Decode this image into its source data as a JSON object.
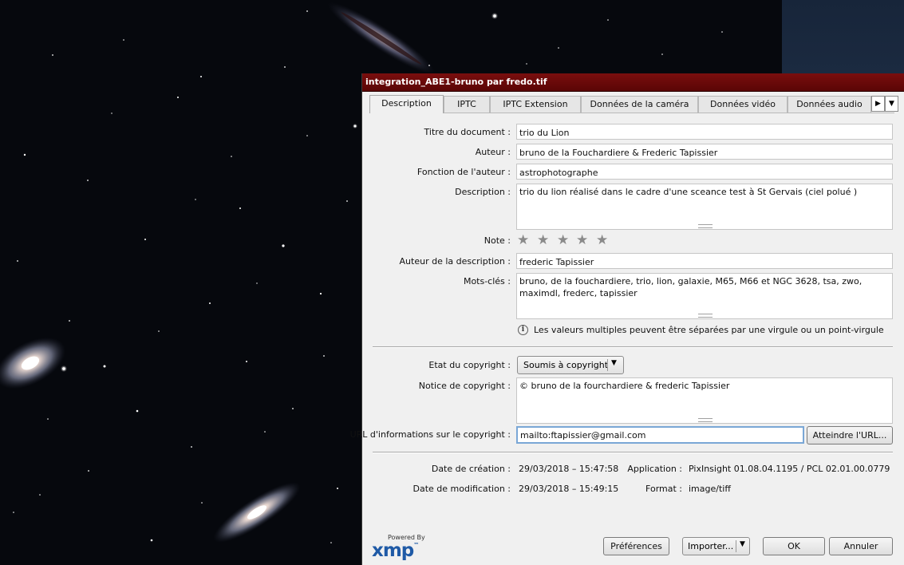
{
  "window": {
    "title": "integration_ABE1-bruno par fredo.tif"
  },
  "tabs": [
    {
      "label": "Description",
      "active": true
    },
    {
      "label": "IPTC"
    },
    {
      "label": "IPTC Extension"
    },
    {
      "label": "Données de la caméra"
    },
    {
      "label": "Données vidéo"
    },
    {
      "label": "Données audio"
    }
  ],
  "tab_scroll": {
    "right_icon": "triangle-right-icon",
    "menu_icon": "triangle-down-icon"
  },
  "form": {
    "document_title": {
      "label": "Titre du document :",
      "value": "trio du Lion"
    },
    "author": {
      "label": "Auteur :",
      "value": "bruno de la Fouchardiere & Frederic Tapissier"
    },
    "author_title": {
      "label": "Fonction de l'auteur :",
      "value": "astrophotographe"
    },
    "description": {
      "label": "Description :",
      "value": "trio du lion réalisé dans le cadre d'une sceance test à St Gervais (ciel polué )"
    },
    "rating": {
      "label": "Note :",
      "stars_total": 5,
      "stars_filled": 0
    },
    "description_writer": {
      "label": "Auteur de la description :",
      "value": "frederic Tapissier"
    },
    "keywords": {
      "label": "Mots-clés :",
      "value": "bruno, de la fouchardiere, trio, lion, galaxie, M65, M66 et NGC 3628, tsa, zwo, maximdl, frederc, tapissier"
    },
    "keywords_hint": "Les valeurs multiples peuvent être séparées par une virgule ou un point-virgule",
    "copyright_status": {
      "label": "Etat du copyright :",
      "value": "Soumis à copyright"
    },
    "copyright_notice": {
      "label": "Notice de copyright :",
      "value": "© bruno de la fourchardiere & frederic Tapissier"
    },
    "copyright_url": {
      "label": "URL d'informations sur le copyright :",
      "value": "mailto:ftapissier@gmail.com",
      "button": "Atteindre l'URL..."
    }
  },
  "meta": {
    "created": {
      "label": "Date de création :",
      "value": "29/03/2018 – 15:47:58"
    },
    "modified": {
      "label": "Date de modification :",
      "value": "29/03/2018 – 15:49:15"
    },
    "application": {
      "label": "Application :",
      "value": "PixInsight 01.08.04.1195 / PCL 02.01.00.0779"
    },
    "format": {
      "label": "Format :",
      "value": "image/tiff"
    }
  },
  "footer": {
    "powered_by": "Powered By",
    "logo": "xmp",
    "logo_tm": "™",
    "preferences": "Préférences",
    "import": "Importer...",
    "ok": "OK",
    "cancel": "Annuler"
  },
  "colors": {
    "titlebar": "#6b0a0a",
    "xmp_blue": "#1f5aa6",
    "url_focus": "#7aa7d6"
  }
}
